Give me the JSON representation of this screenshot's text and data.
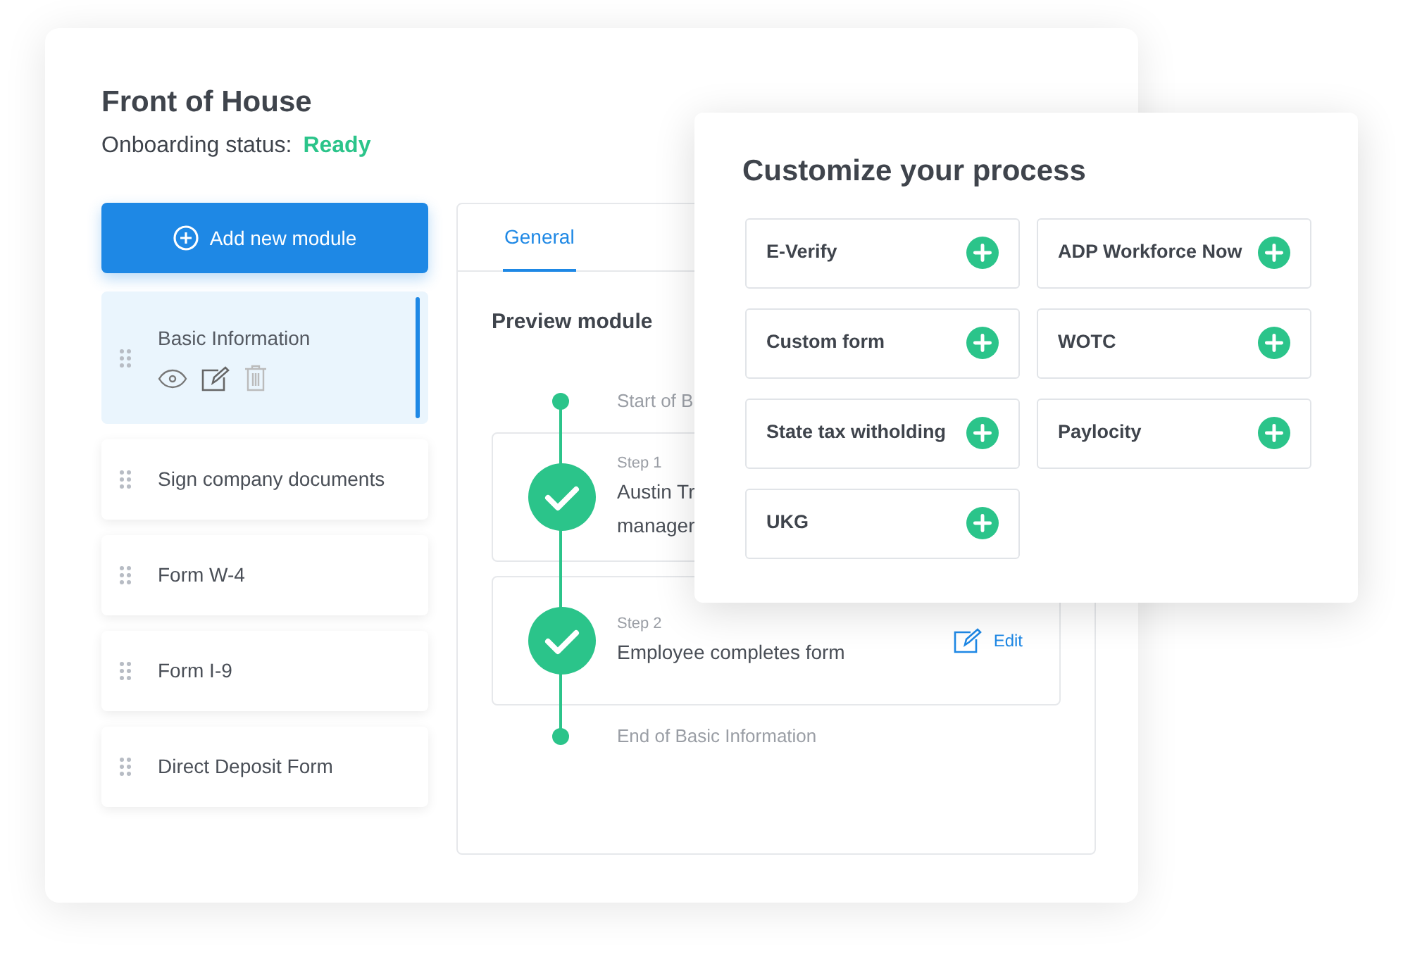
{
  "card": {
    "title": "Front of House",
    "status_label": "Onboarding status:",
    "status_value": "Ready"
  },
  "add_button": "Add new module",
  "modules": [
    {
      "label": "Basic Information",
      "selected": true
    },
    {
      "label": "Sign company documents",
      "selected": false
    },
    {
      "label": "Form W-4",
      "selected": false
    },
    {
      "label": "Form I-9",
      "selected": false
    },
    {
      "label": "Direct Deposit Form",
      "selected": false
    }
  ],
  "tabs": [
    {
      "label": "General",
      "selected": true
    }
  ],
  "preview": {
    "title": "Preview module",
    "timeline": [
      {
        "kind": "start",
        "text": "Start of B"
      },
      {
        "kind": "step",
        "step": "Step 1",
        "lines": [
          "Austin Tr",
          "manager"
        ]
      },
      {
        "kind": "step",
        "step": "Step 2",
        "lines": [
          "Employee completes form"
        ],
        "action": "Edit"
      },
      {
        "kind": "end",
        "text": "End of Basic Information"
      }
    ]
  },
  "customize": {
    "title": "Customize your process",
    "options": [
      {
        "label": "E-Verify"
      },
      {
        "label": "ADP Workforce Now"
      },
      {
        "label": "Custom form"
      },
      {
        "label": "WOTC"
      },
      {
        "label": "State tax witholding"
      },
      {
        "label": "Paylocity"
      },
      {
        "label": "UKG"
      }
    ]
  }
}
